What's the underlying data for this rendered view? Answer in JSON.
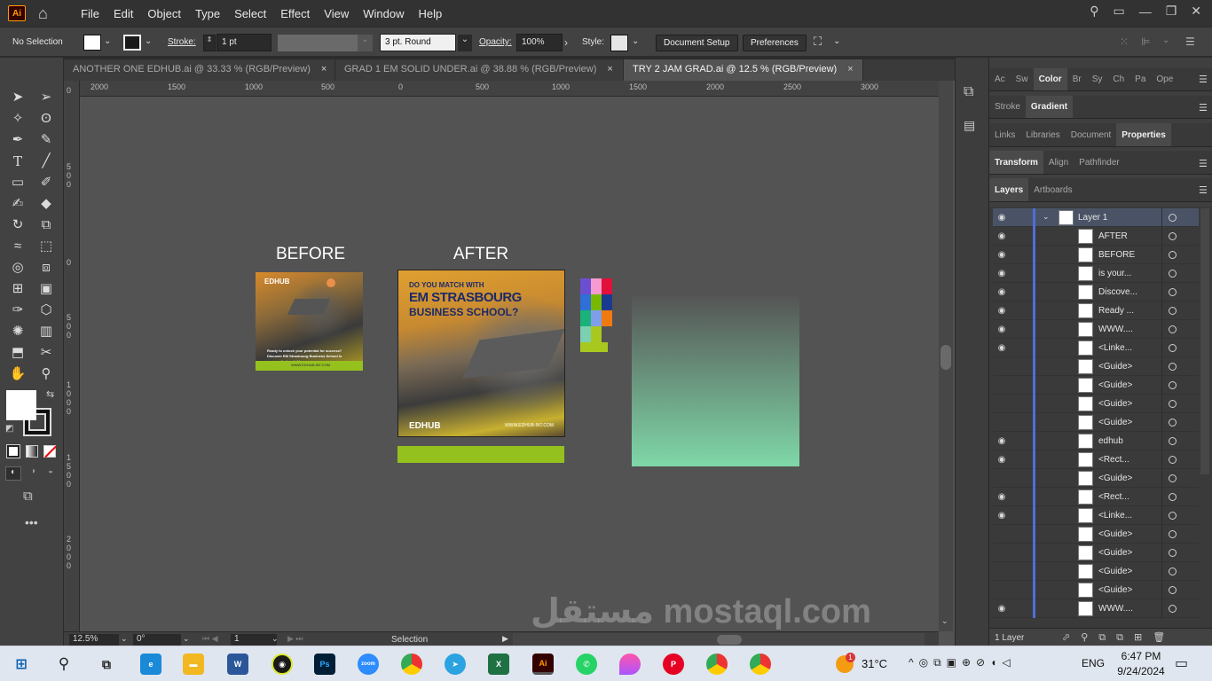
{
  "app": {
    "logo": "Ai",
    "menus": [
      "File",
      "Edit",
      "Object",
      "Type",
      "Select",
      "Effect",
      "View",
      "Window",
      "Help"
    ]
  },
  "control": {
    "selection": "No Selection",
    "stroke_label": "Stroke:",
    "stroke_value": "1 pt",
    "brush_value": "3 pt. Round",
    "opacity_label": "Opacity:",
    "opacity_value": "100%",
    "style_label": "Style:",
    "document_setup": "Document Setup",
    "preferences": "Preferences"
  },
  "tabs": [
    {
      "label": "ANOTHER ONE EDHUB.ai @ 33.33 % (RGB/Preview)",
      "close": "×"
    },
    {
      "label": "GRAD 1 EM SOLID UNDER.ai @ 38.88 % (RGB/Preview)",
      "close": "×"
    },
    {
      "label": "TRY 2 JAM GRAD.ai @ 12.5 % (RGB/Preview)",
      "close": "×"
    }
  ],
  "ruler": {
    "top": [
      "2000",
      "1500",
      "1000",
      "500",
      "0",
      "500",
      "1000",
      "1500",
      "2000",
      "2500",
      "3000"
    ],
    "left": [
      "0",
      "5\n0\n0",
      "0",
      "5\n0\n0",
      "1\n0\n0\n0",
      "1\n5\n0\n0",
      "2\n0\n0\n0"
    ]
  },
  "canvas": {
    "before_label": "BEFORE",
    "after_label": "AFTER",
    "before_card": {
      "brand": "EDHUB",
      "text": "Ready to unlock your potential for success? Discover EM Strasbourg Business School is your perfect match!",
      "url": "WWW.EDHUB-INT.COM"
    },
    "after_card": {
      "headline1": "DO YOU MATCH WITH",
      "headline2": "EM STRASBOURG",
      "headline3": "BUSINESS SCHOOL?",
      "brand": "EDHUB",
      "url": "WWW.EDHUB-INT.COM"
    },
    "swatches": [
      "#6a4fd0",
      "#f59bd0",
      "#e0113a",
      "#2f6fd8",
      "#78b800",
      "#1a3a90",
      "#1ab27a",
      "#7e9ee8",
      "#f07a10",
      "#7ad0b0",
      "#a8c820"
    ],
    "colors": {
      "lime": "#95c11f",
      "gradient_top": "#555555",
      "gradient_bottom": "#7fd8a8"
    }
  },
  "status": {
    "zoom": "12.5%",
    "rotation": "0°",
    "artboard": "1",
    "tool": "Selection"
  },
  "panels": {
    "row1": [
      "Ac",
      "Sw",
      "Color",
      "Br",
      "Sy",
      "Ch",
      "Pa",
      "Ope"
    ],
    "row2": [
      "Stroke",
      "Gradient"
    ],
    "row3": [
      "Links",
      "Libraries",
      "Document",
      "Properties"
    ],
    "row4": [
      "Transform",
      "Align",
      "Pathfinder"
    ],
    "row5": [
      "Layers",
      "Artboards"
    ],
    "footer": "1 Layer"
  },
  "layers": [
    {
      "name": "Layer 1",
      "eye": true,
      "top": true
    },
    {
      "name": "AFTER",
      "eye": true
    },
    {
      "name": "BEFORE",
      "eye": true
    },
    {
      "name": "is your...",
      "eye": true
    },
    {
      "name": "Discove...",
      "eye": true
    },
    {
      "name": "Ready ...",
      "eye": true
    },
    {
      "name": "WWW....",
      "eye": true
    },
    {
      "name": "<Linke...",
      "eye": true
    },
    {
      "name": "<Guide>",
      "eye": false
    },
    {
      "name": "<Guide>",
      "eye": false
    },
    {
      "name": "<Guide>",
      "eye": false
    },
    {
      "name": "<Guide>",
      "eye": false
    },
    {
      "name": "edhub",
      "eye": true
    },
    {
      "name": "<Rect...",
      "eye": true
    },
    {
      "name": "<Guide>",
      "eye": false
    },
    {
      "name": "<Rect...",
      "eye": true
    },
    {
      "name": "<Linke...",
      "eye": true
    },
    {
      "name": "<Guide>",
      "eye": false
    },
    {
      "name": "<Guide>",
      "eye": false
    },
    {
      "name": "<Guide>",
      "eye": false
    },
    {
      "name": "<Guide>",
      "eye": false
    },
    {
      "name": "WWW....",
      "eye": true
    }
  ],
  "taskbar": {
    "weather": "31°C",
    "lang": "ENG",
    "time": "6:47 PM",
    "date": "9/24/2024",
    "weather_badge": "1"
  },
  "watermark": "مستقل mostaql.com"
}
